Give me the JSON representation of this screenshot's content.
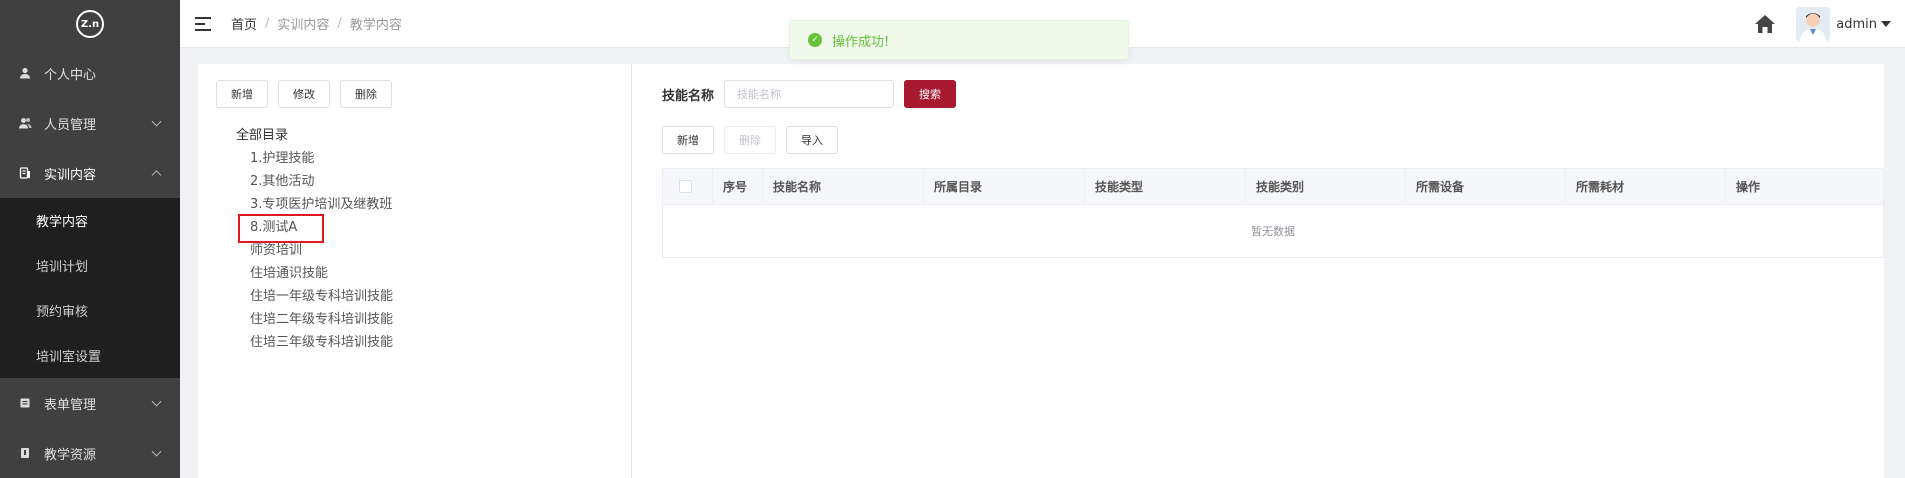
{
  "sidebar": {
    "logo_text": "Z.n",
    "items": [
      {
        "label": "个人中心",
        "icon": "user-icon",
        "has_children": false
      },
      {
        "label": "人员管理",
        "icon": "users-icon",
        "has_children": true
      },
      {
        "label": "实训内容",
        "icon": "book-icon",
        "has_children": true,
        "expanded": true,
        "children": [
          {
            "label": "教学内容",
            "active": true
          },
          {
            "label": "培训计划"
          },
          {
            "label": "预约审核"
          },
          {
            "label": "培训室设置"
          }
        ]
      },
      {
        "label": "表单管理",
        "icon": "form-icon",
        "has_children": true
      },
      {
        "label": "教学资源",
        "icon": "resource-icon",
        "has_children": true
      }
    ]
  },
  "header": {
    "breadcrumb": [
      "首页",
      "实训内容",
      "教学内容"
    ],
    "username": "admin"
  },
  "toast": {
    "message": "操作成功!",
    "color": "#67c23a"
  },
  "left_panel": {
    "buttons": {
      "add": "新增",
      "edit": "修改",
      "delete": "删除"
    },
    "tree_root": "全部目录",
    "tree_nodes": [
      "1.护理技能",
      "2.其他活动",
      "3.专项医护培训及继教班",
      "8.测试A",
      "师资培训",
      "住培通识技能",
      "住培一年级专科培训技能",
      "住培二年级专科培训技能",
      "住培三年级专科培训技能"
    ]
  },
  "right_panel": {
    "search_label": "技能名称",
    "search_placeholder": "技能名称",
    "search_button": "搜索",
    "actions": {
      "add": "新增",
      "delete": "删除",
      "import": "导入"
    },
    "columns": [
      "序号",
      "技能名称",
      "所属目录",
      "技能类型",
      "技能类别",
      "所需设备",
      "所需耗材",
      "操作"
    ],
    "empty_text": "暂无数据"
  },
  "colors": {
    "sidebar_bg": "#404040",
    "submenu_bg": "#1f1f1f",
    "primary": "#a8182f",
    "highlight": "#e0191e"
  }
}
